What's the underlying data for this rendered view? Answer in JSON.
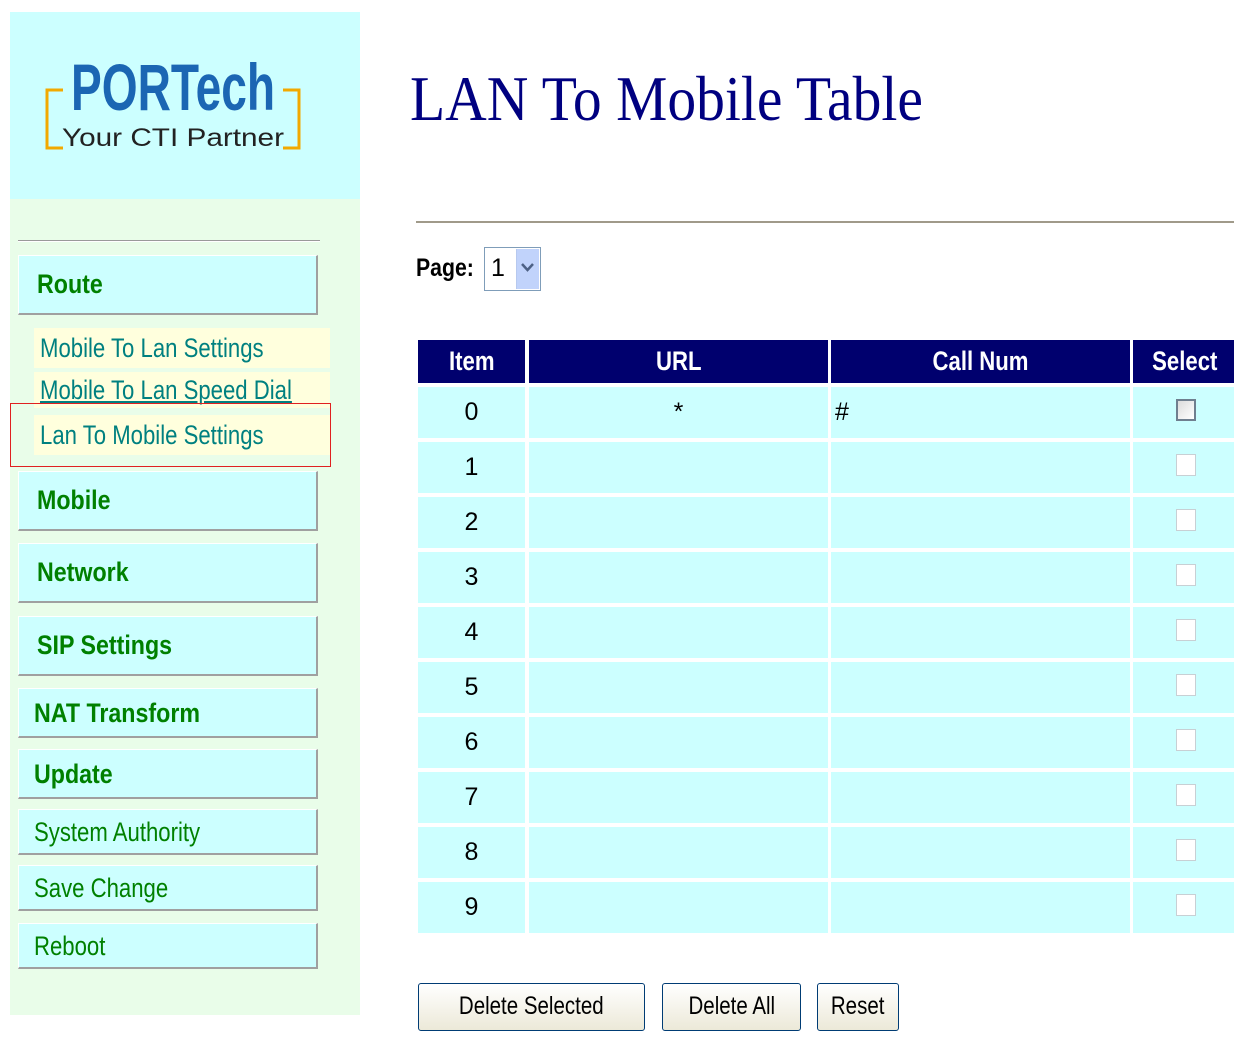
{
  "logo": {
    "brand": "PORTech",
    "tagline": "Your CTI Partner"
  },
  "sidebar": {
    "route_label": "Route",
    "route_items": [
      {
        "label": "Mobile To Lan Settings"
      },
      {
        "label": "Mobile To Lan Speed Dial"
      },
      {
        "label": "Lan To Mobile Settings"
      }
    ],
    "mobile_label": "Mobile",
    "network_label": "Network",
    "sip_label": "SIP Settings",
    "nat_label": "NAT Transform",
    "update_label": "Update",
    "system_authority_label": "System Authority",
    "save_change_label": "Save Change",
    "reboot_label": "Reboot"
  },
  "main": {
    "title": "LAN To Mobile Table",
    "page_label": "Page:",
    "page_value": "1",
    "table": {
      "headers": {
        "item": "Item",
        "url": "URL",
        "call_num": "Call Num",
        "select": "Select"
      },
      "rows": [
        {
          "item": "0",
          "url": "*",
          "call_num": "#",
          "enabled": true
        },
        {
          "item": "1",
          "url": "",
          "call_num": "",
          "enabled": false
        },
        {
          "item": "2",
          "url": "",
          "call_num": "",
          "enabled": false
        },
        {
          "item": "3",
          "url": "",
          "call_num": "",
          "enabled": false
        },
        {
          "item": "4",
          "url": "",
          "call_num": "",
          "enabled": false
        },
        {
          "item": "5",
          "url": "",
          "call_num": "",
          "enabled": false
        },
        {
          "item": "6",
          "url": "",
          "call_num": "",
          "enabled": false
        },
        {
          "item": "7",
          "url": "",
          "call_num": "",
          "enabled": false
        },
        {
          "item": "8",
          "url": "",
          "call_num": "",
          "enabled": false
        },
        {
          "item": "9",
          "url": "",
          "call_num": "",
          "enabled": false
        }
      ]
    },
    "buttons": {
      "delete_selected": "Delete Selected",
      "delete_all": "Delete All",
      "reset": "Reset"
    }
  },
  "colors": {
    "header_bg": "#00006e",
    "cell_bg": "#ccffff",
    "title": "#000080",
    "menu_text": "#008000",
    "submenu_text": "#008080",
    "highlight_border": "#e02020"
  }
}
